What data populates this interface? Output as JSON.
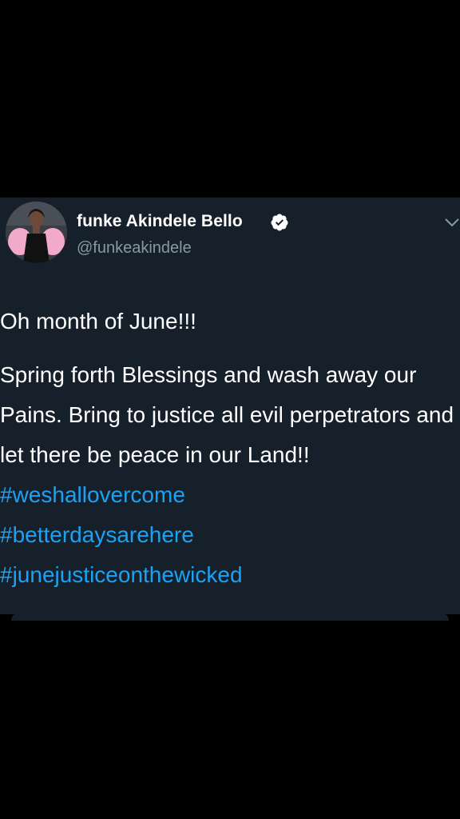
{
  "tweet": {
    "display_name": "funke Akindele Bello",
    "handle": "@funkeakindele",
    "verified_icon": "verified-badge-icon",
    "menu_icon": "chevron-down-icon",
    "line1": "Oh month of June!!!",
    "body_text": "Spring forth Blessings and wash away our Pains. Bring to justice all evil perpetrators and let there be peace in our Land!!",
    "hashtags": [
      "#weshallovercome",
      "#betterdaysarehere",
      "#junejusticeonthewicked"
    ]
  },
  "colors": {
    "background": "#000000",
    "card": "#15202b",
    "text": "#ffffff",
    "secondary_text": "#8899a6",
    "link": "#1da1f2"
  }
}
